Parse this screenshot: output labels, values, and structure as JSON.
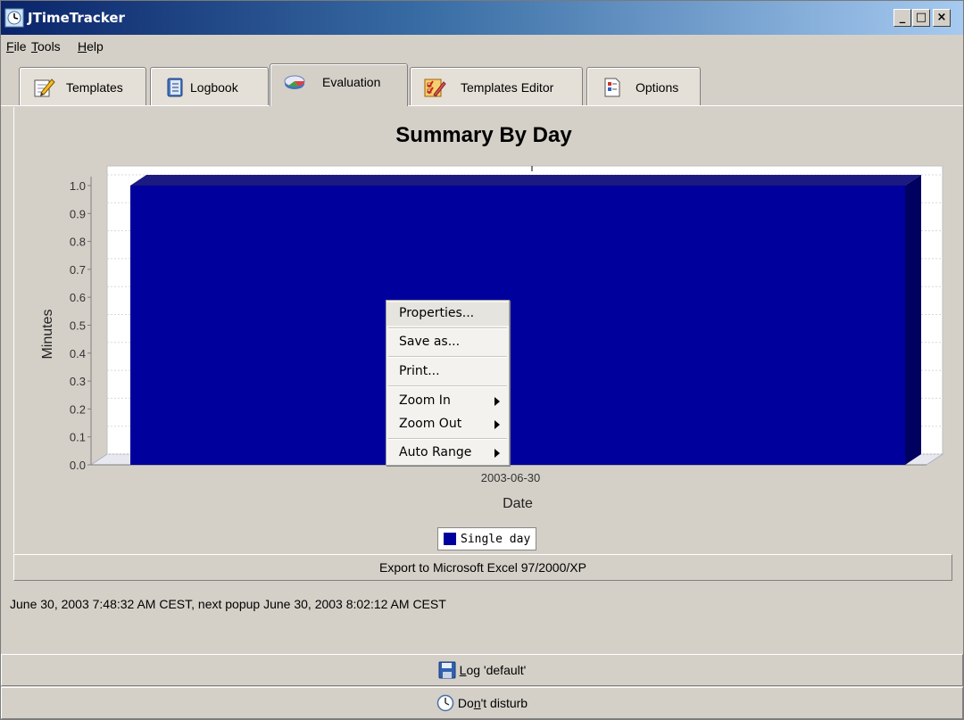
{
  "window": {
    "title": "JTimeTracker",
    "controls": [
      "_",
      "□",
      "×"
    ]
  },
  "menubar": {
    "items": [
      {
        "label_u": "F",
        "label_rest": "ile"
      },
      {
        "label_u": "T",
        "label_rest": "ools"
      },
      {
        "label_u": "H",
        "label_rest": "elp"
      }
    ]
  },
  "tabs": [
    {
      "label": "Templates",
      "icon": "pencil-notepad-icon",
      "active": false
    },
    {
      "label": "Logbook",
      "icon": "logbook-icon",
      "active": false
    },
    {
      "label": "Evaluation",
      "icon": "pie-chart-icon",
      "active": true
    },
    {
      "label": "Templates Editor",
      "icon": "checklist-pencil-icon",
      "active": false
    },
    {
      "label": "Options",
      "icon": "options-document-icon",
      "active": false
    }
  ],
  "chart_data": {
    "type": "bar",
    "title": "Summary By Day",
    "xlabel": "Date",
    "ylabel": "Minutes",
    "categories": [
      "2003-06-30"
    ],
    "series": [
      {
        "name": "Single day",
        "values": [
          1.0
        ],
        "color": "#00009c"
      }
    ],
    "ylim": [
      0.0,
      1.0
    ],
    "yticks": [
      "0.0",
      "0.1",
      "0.2",
      "0.3",
      "0.4",
      "0.5",
      "0.6",
      "0.7",
      "0.8",
      "0.9",
      "1.0"
    ],
    "grid": true,
    "legend": "bottom",
    "style": "3d"
  },
  "context_menu": {
    "items": [
      {
        "label": "Properties...",
        "submenu": false
      },
      {
        "label": "Save as...",
        "submenu": false
      },
      {
        "label": "Print...",
        "submenu": false
      },
      {
        "label": "Zoom In",
        "submenu": true
      },
      {
        "label": "Zoom Out",
        "submenu": true
      },
      {
        "label": "Auto Range",
        "submenu": true
      }
    ]
  },
  "export_button": "Export to Microsoft Excel 97/2000/XP",
  "status": "June 30, 2003 7:48:32 AM CEST, next popup June 30, 2003 8:02:12 AM CEST",
  "log_button": {
    "u": "L",
    "rest": "og 'default'"
  },
  "dnd_button": {
    "pre": "Do",
    "u": "n",
    "rest": "'t disturb"
  },
  "colors": {
    "bar": "#00009c",
    "bar_side": "#000060",
    "bar_top": "#1a1a80",
    "face": "#d4d0c8"
  }
}
